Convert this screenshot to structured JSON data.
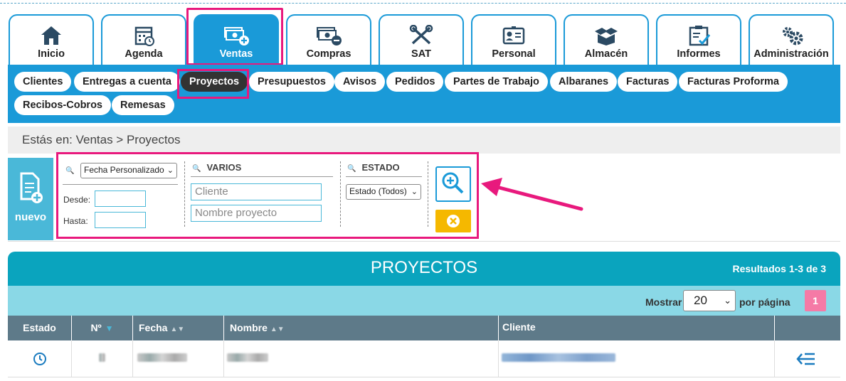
{
  "modules": [
    {
      "label": "Inicio",
      "icon": "home-icon"
    },
    {
      "label": "Agenda",
      "icon": "calendar-icon"
    },
    {
      "label": "Ventas",
      "icon": "money-plus-icon"
    },
    {
      "label": "Compras",
      "icon": "money-minus-icon"
    },
    {
      "label": "SAT",
      "icon": "tools-icon"
    },
    {
      "label": "Personal",
      "icon": "id-card-icon"
    },
    {
      "label": "Almacén",
      "icon": "boxes-icon"
    },
    {
      "label": "Informes",
      "icon": "clipboard-icon"
    },
    {
      "label": "Administración",
      "icon": "gears-icon"
    }
  ],
  "submenu": {
    "items": [
      "Clientes",
      "Entregas a cuenta",
      "Proyectos",
      "Presupuestos",
      "Avisos",
      "Pedidos",
      "Partes de Trabajo",
      "Albaranes",
      "Facturas",
      "Facturas Proforma",
      "Recibos-Cobros",
      "Remesas"
    ]
  },
  "breadcrumb": "Estás en: Ventas > Proyectos",
  "nuevo_label": "nuevo",
  "filters": {
    "date_select": "Fecha Personalizado",
    "desde_label": "Desde:",
    "hasta_label": "Hasta:",
    "varios_title": "VARIOS",
    "cliente_placeholder": "Cliente",
    "nombre_placeholder": "Nombre proyecto",
    "estado_title": "ESTADO",
    "estado_select": "Estado (Todos)"
  },
  "results": {
    "title": "PROYECTOS",
    "count": "Resultados 1-3 de 3",
    "mostrar_label": "Mostrar",
    "per_page": "20",
    "por_pagina_label": "por página",
    "page": "1"
  },
  "table": {
    "columns": [
      "Estado",
      "Nº",
      "Fecha",
      "Nombre",
      "Cliente",
      ""
    ]
  },
  "colors": {
    "primary": "#1a9ad8",
    "highlight": "#e8197d",
    "results_header": "#0aa4be",
    "table_header": "#5e7a89"
  }
}
